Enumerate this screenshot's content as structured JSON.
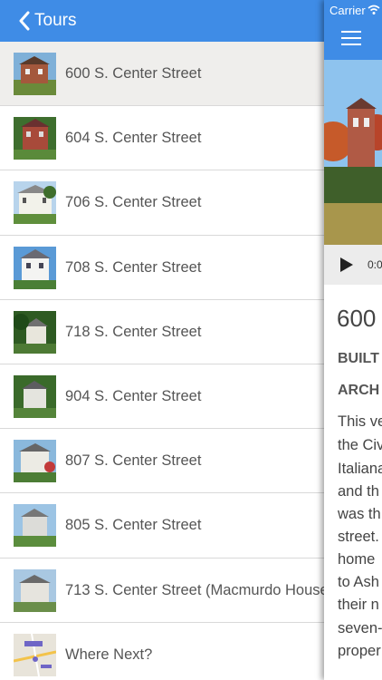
{
  "nav": {
    "back_label": "Tours"
  },
  "tours": [
    {
      "label": "600 S. Center Street"
    },
    {
      "label": "604 S. Center Street"
    },
    {
      "label": "706 S. Center Street"
    },
    {
      "label": "708 S. Center Street"
    },
    {
      "label": "718 S. Center Street"
    },
    {
      "label": "904 S. Center Street"
    },
    {
      "label": "807 S. Center Street"
    },
    {
      "label": "805 S. Center Street"
    },
    {
      "label": "713 S. Center Street (Macmurdo House)"
    },
    {
      "label": "Where Next?"
    }
  ],
  "status": {
    "carrier": "Carrier"
  },
  "detail": {
    "time": "0:0",
    "title": "600",
    "field1": "BUILT",
    "field2": "ARCH",
    "lines": [
      "This ve",
      "the Civ",
      "Italiana",
      "and th",
      "was th",
      "street.",
      "home",
      "to Ash",
      "their n",
      "seven-",
      "proper"
    ]
  },
  "colors": {
    "accent": "#3f8ce6",
    "selected_row": "#efeeec"
  }
}
